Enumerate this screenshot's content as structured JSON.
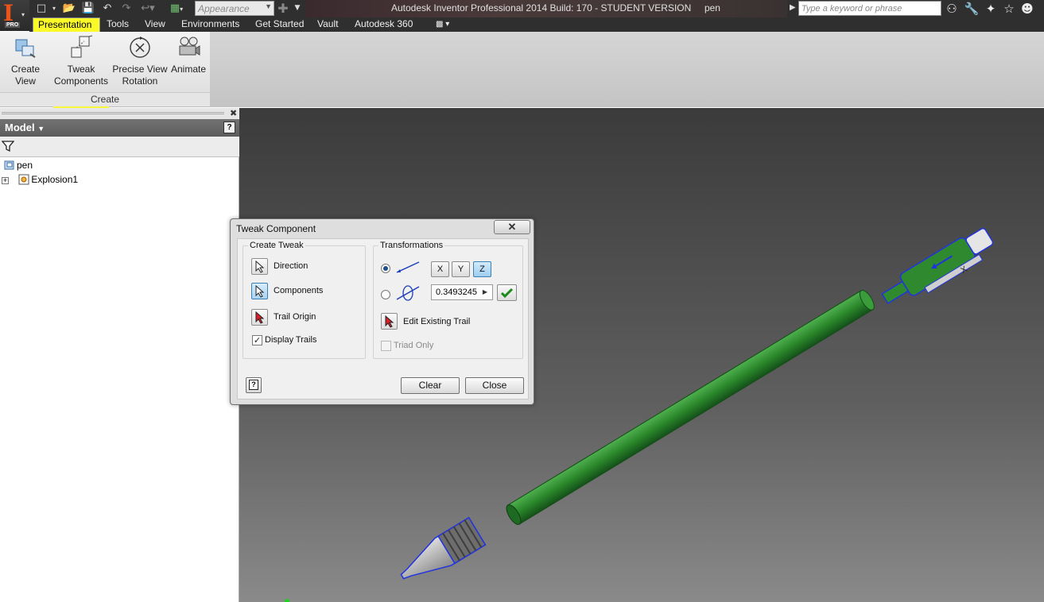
{
  "titlebar": {
    "appearance_placeholder": "Appearance",
    "title": "Autodesk Inventor Professional 2014 Build: 170 - STUDENT VERSION     pen",
    "search_placeholder": "Type a keyword or phrase",
    "logo_badge": "PRO"
  },
  "menu": {
    "tabs": [
      "Presentation",
      "Tools",
      "View",
      "Environments",
      "Get Started",
      "Vault",
      "Autodesk 360"
    ],
    "active_tab": "Presentation"
  },
  "ribbon": {
    "create_view": "Create View",
    "tweak_line1": "Tweak",
    "tweak_line2": "Components",
    "precise_line1": "Precise View",
    "precise_line2": "Rotation",
    "animate": "Animate",
    "panel_label": "Create"
  },
  "browser": {
    "header": "Model",
    "tree": [
      {
        "label": "pen"
      },
      {
        "label": "Explosion1"
      }
    ]
  },
  "dialog": {
    "title": "Tweak Component",
    "create_tweak": {
      "label": "Create Tweak",
      "direction": "Direction",
      "components": "Components",
      "trail_origin": "Trail Origin",
      "display_trails": "Display Trails"
    },
    "transformations": {
      "label": "Transformations",
      "axes": [
        "X",
        "Y",
        "Z"
      ],
      "active_axis": "Z",
      "value": "0.3493245",
      "edit_existing_trail": "Edit Existing Trail",
      "triad_only": "Triad Only"
    },
    "buttons": {
      "clear": "Clear",
      "close": "Close"
    }
  },
  "colors": {
    "part_green": "#2f8a2f",
    "highlight_yellow": "#fafa28",
    "selection_blue": "#2233dd"
  }
}
